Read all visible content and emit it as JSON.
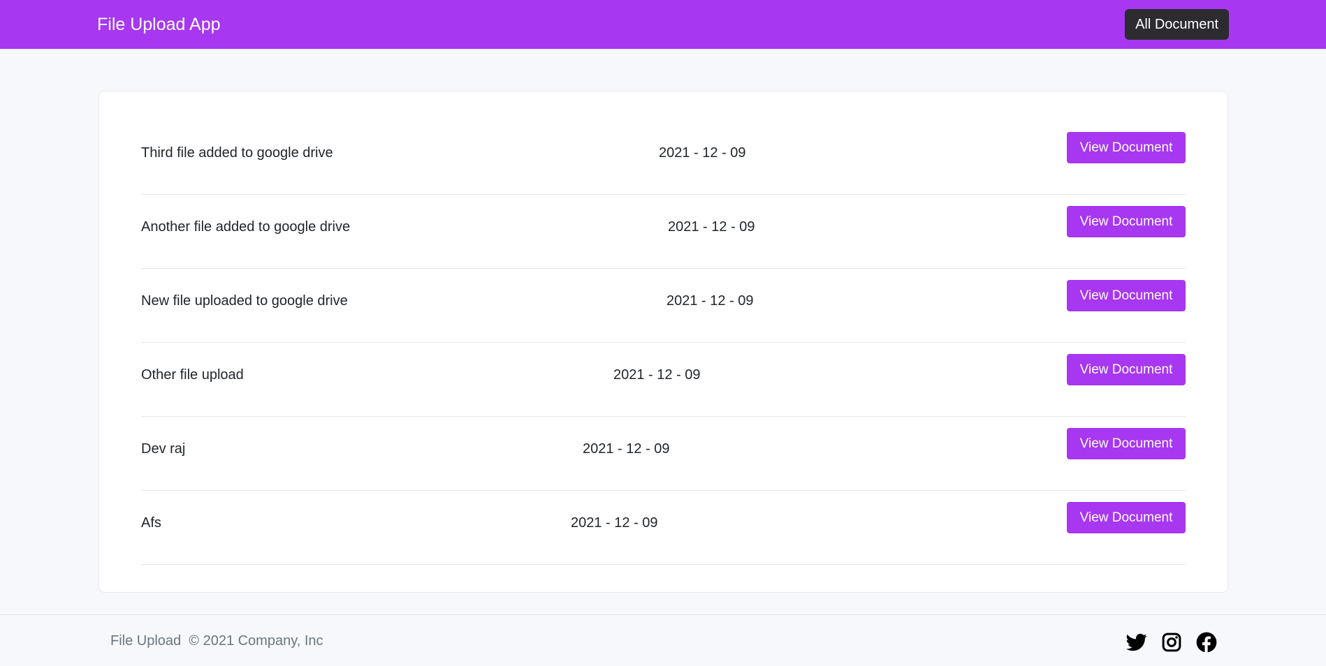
{
  "navbar": {
    "brand": "File Upload App",
    "button_label": "All Document"
  },
  "documents": [
    {
      "title": "Third file added to google drive",
      "date": "2021 - 12 - 09",
      "button": "View Document"
    },
    {
      "title": "Another file added to google drive",
      "date": "2021 - 12 - 09",
      "button": "View Document"
    },
    {
      "title": "New file uploaded to google drive",
      "date": "2021 - 12 - 09",
      "button": "View Document"
    },
    {
      "title": "Other file upload",
      "date": "2021 - 12 - 09",
      "button": "View Document"
    },
    {
      "title": "Dev raj",
      "date": "2021 - 12 - 09",
      "button": "View Document"
    },
    {
      "title": "Afs",
      "date": "2021 - 12 - 09",
      "button": "View Document"
    }
  ],
  "footer": {
    "text": "File Upload  © 2021 Company, Inc",
    "social_icons": [
      "twitter-icon",
      "instagram-icon",
      "facebook-icon"
    ]
  },
  "colors": {
    "accent": "#a737f0",
    "dark_button": "#2b2b30",
    "background": "#f7f8fc"
  }
}
